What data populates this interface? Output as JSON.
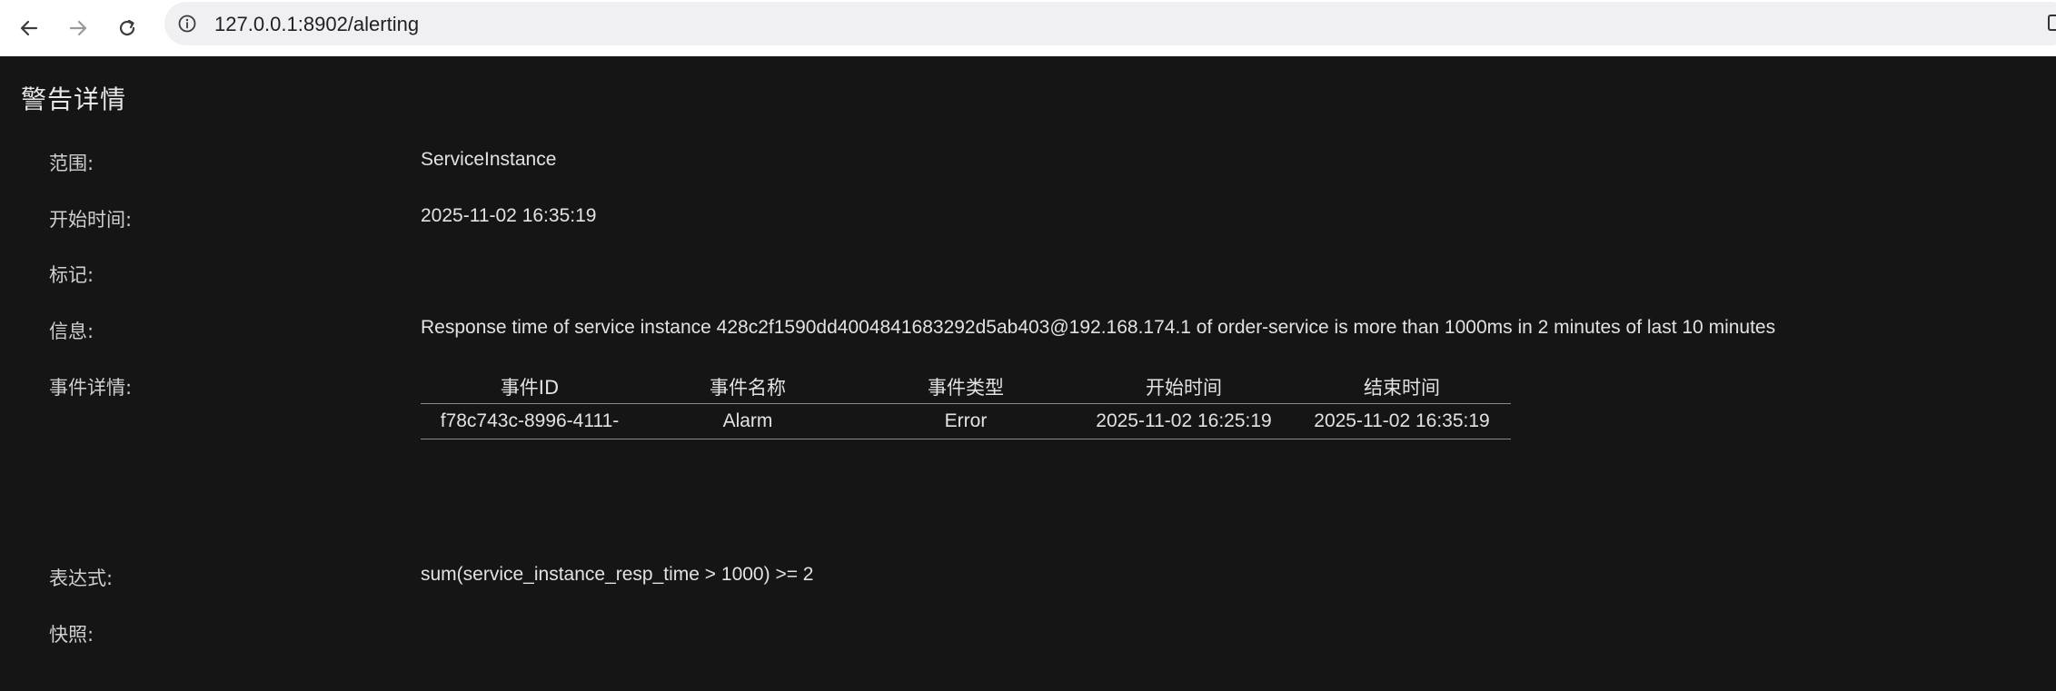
{
  "browser": {
    "url": "127.0.0.1:8902/alerting",
    "back_icon": "arrow-left-icon",
    "forward_icon": "arrow-right-icon",
    "reload_icon": "reload-icon",
    "info_icon": "info-icon"
  },
  "page": {
    "title": "警告详情",
    "fields": {
      "scope_label": "范围:",
      "scope_value": "ServiceInstance",
      "start_time_label": "开始时间:",
      "start_time_value": "2025-11-02 16:35:19",
      "tags_label": "标记:",
      "tags_value": "",
      "message_label": "信息:",
      "message_value": "Response time of service instance 428c2f1590dd4004841683292d5ab403@192.168.174.1 of order-service is more than 1000ms in 2 minutes of last 10 minutes",
      "event_details_label": "事件详情:",
      "expression_label": "表达式:",
      "expression_value": "sum(service_instance_resp_time > 1000) >= 2",
      "snapshot_label": "快照:"
    },
    "events_table": {
      "headers": [
        "事件ID",
        "事件名称",
        "事件类型",
        "开始时间",
        "结束时间"
      ],
      "rows": [
        [
          "f78c743c-8996-4111-",
          "Alarm",
          "Error",
          "2025-11-02 16:25:19",
          "2025-11-02 16:35:19"
        ]
      ]
    }
  },
  "colors": {
    "background": "#151515",
    "text": "#e2e2e2",
    "label": "#cfcfcf",
    "table_border": "#8a8a8a"
  }
}
